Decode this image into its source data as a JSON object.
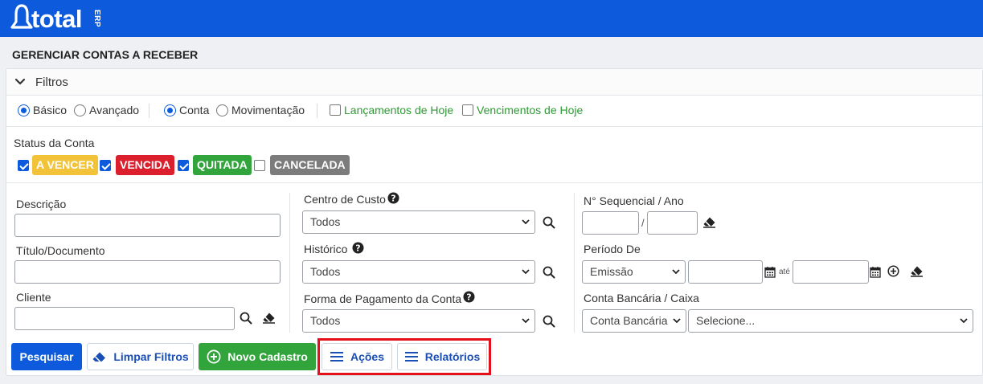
{
  "brand": {
    "name": "total",
    "suffix": "ERP"
  },
  "page_title": "GERENCIAR CONTAS A RECEBER",
  "filters": {
    "title": "Filtros",
    "mode": {
      "basic": "Básico",
      "advanced": "Avançado"
    },
    "scope": {
      "account": "Conta",
      "movement": "Movimentação"
    },
    "today_entries": "Lançamentos de Hoje",
    "today_due": "Vencimentos de Hoje"
  },
  "status": {
    "label": "Status da Conta",
    "items": [
      {
        "label": "A VENCER",
        "checked": true,
        "color": "#f2c339"
      },
      {
        "label": "VENCIDA",
        "checked": true,
        "color": "#dc1f2c"
      },
      {
        "label": "QUITADA",
        "checked": true,
        "color": "#31a53c"
      },
      {
        "label": "CANCELADA",
        "checked": false,
        "color": "#7c7c7c"
      }
    ]
  },
  "fields": {
    "descricao": "Descrição",
    "titulo": "Título/Documento",
    "cliente": "Cliente",
    "centro_custo": {
      "label": "Centro de Custo",
      "value": "Todos"
    },
    "historico": {
      "label": "Histórico",
      "value": "Todos"
    },
    "forma_pagamento": {
      "label": "Forma de Pagamento da Conta",
      "value": "Todos"
    },
    "sequencial": {
      "label": "N° Sequencial / Ano",
      "separator": "/"
    },
    "periodo": {
      "label": "Período De",
      "type": "Emissão",
      "until": "até"
    },
    "conta_bancaria": {
      "label": "Conta Bancária / Caixa",
      "type": "Conta Bancária",
      "value": "Selecione..."
    }
  },
  "buttons": {
    "search": "Pesquisar",
    "clear": "Limpar Filtros",
    "new": "Novo Cadastro",
    "actions": "Ações",
    "reports": "Relatórios"
  },
  "colors": {
    "brand_blue": "#0d5bdc",
    "success_green": "#31a53c",
    "highlight_red": "#e4101a"
  }
}
